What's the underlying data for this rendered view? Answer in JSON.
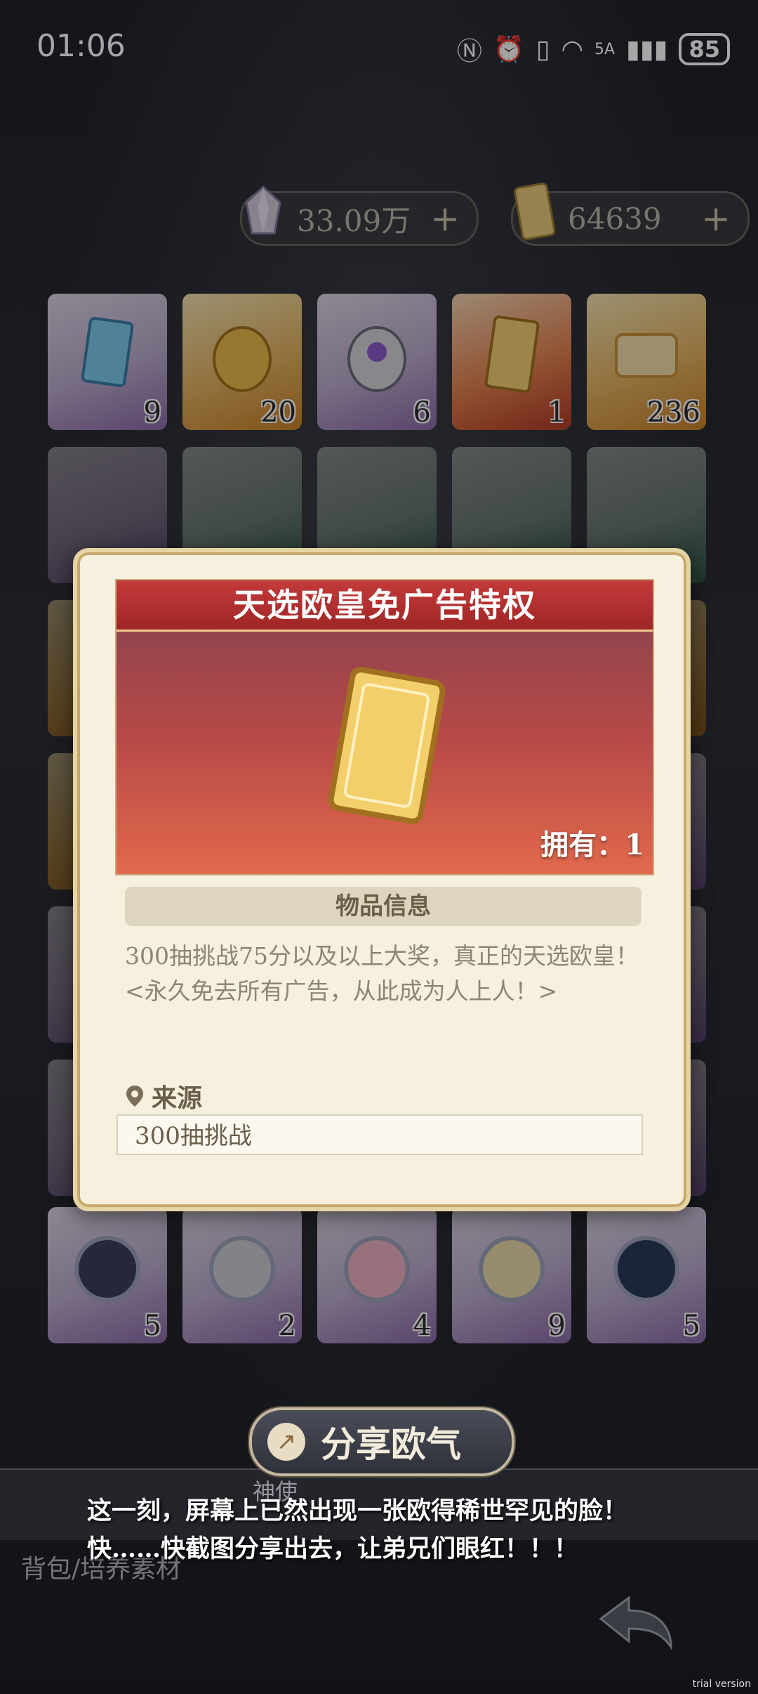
{
  "status_bar": {
    "time": "01:06",
    "battery": "85",
    "network": "5A"
  },
  "currencies": [
    {
      "name": "crystal",
      "value": "33.09万",
      "plus": "+"
    },
    {
      "name": "ticket",
      "value": "64639",
      "plus": "+"
    }
  ],
  "grid_counts": {
    "row1": [
      "9",
      "20",
      "6",
      "1",
      "236"
    ],
    "row7": [
      "5",
      "2",
      "4",
      "9",
      "5"
    ]
  },
  "modal": {
    "title": "天选欧皇免广告特权",
    "own_label": "拥有：1",
    "info_header": "物品信息",
    "description_line1": "300抽挑战75分以及以上大奖，真正的天选欧皇！",
    "description_line2": "<永久免去所有广告，从此成为人上人！>",
    "source_label": "来源",
    "source_value": "300抽挑战"
  },
  "share_button": "分享欧气",
  "caption": {
    "line1": "这一刻，屏幕上已然出现一张欧得稀世罕见的脸！",
    "line2": "快……快截图分享出去，让弟兄们眼红！！！"
  },
  "background_tab": "神使",
  "bag_label": "背包/培养素材",
  "watermark": "trial version"
}
